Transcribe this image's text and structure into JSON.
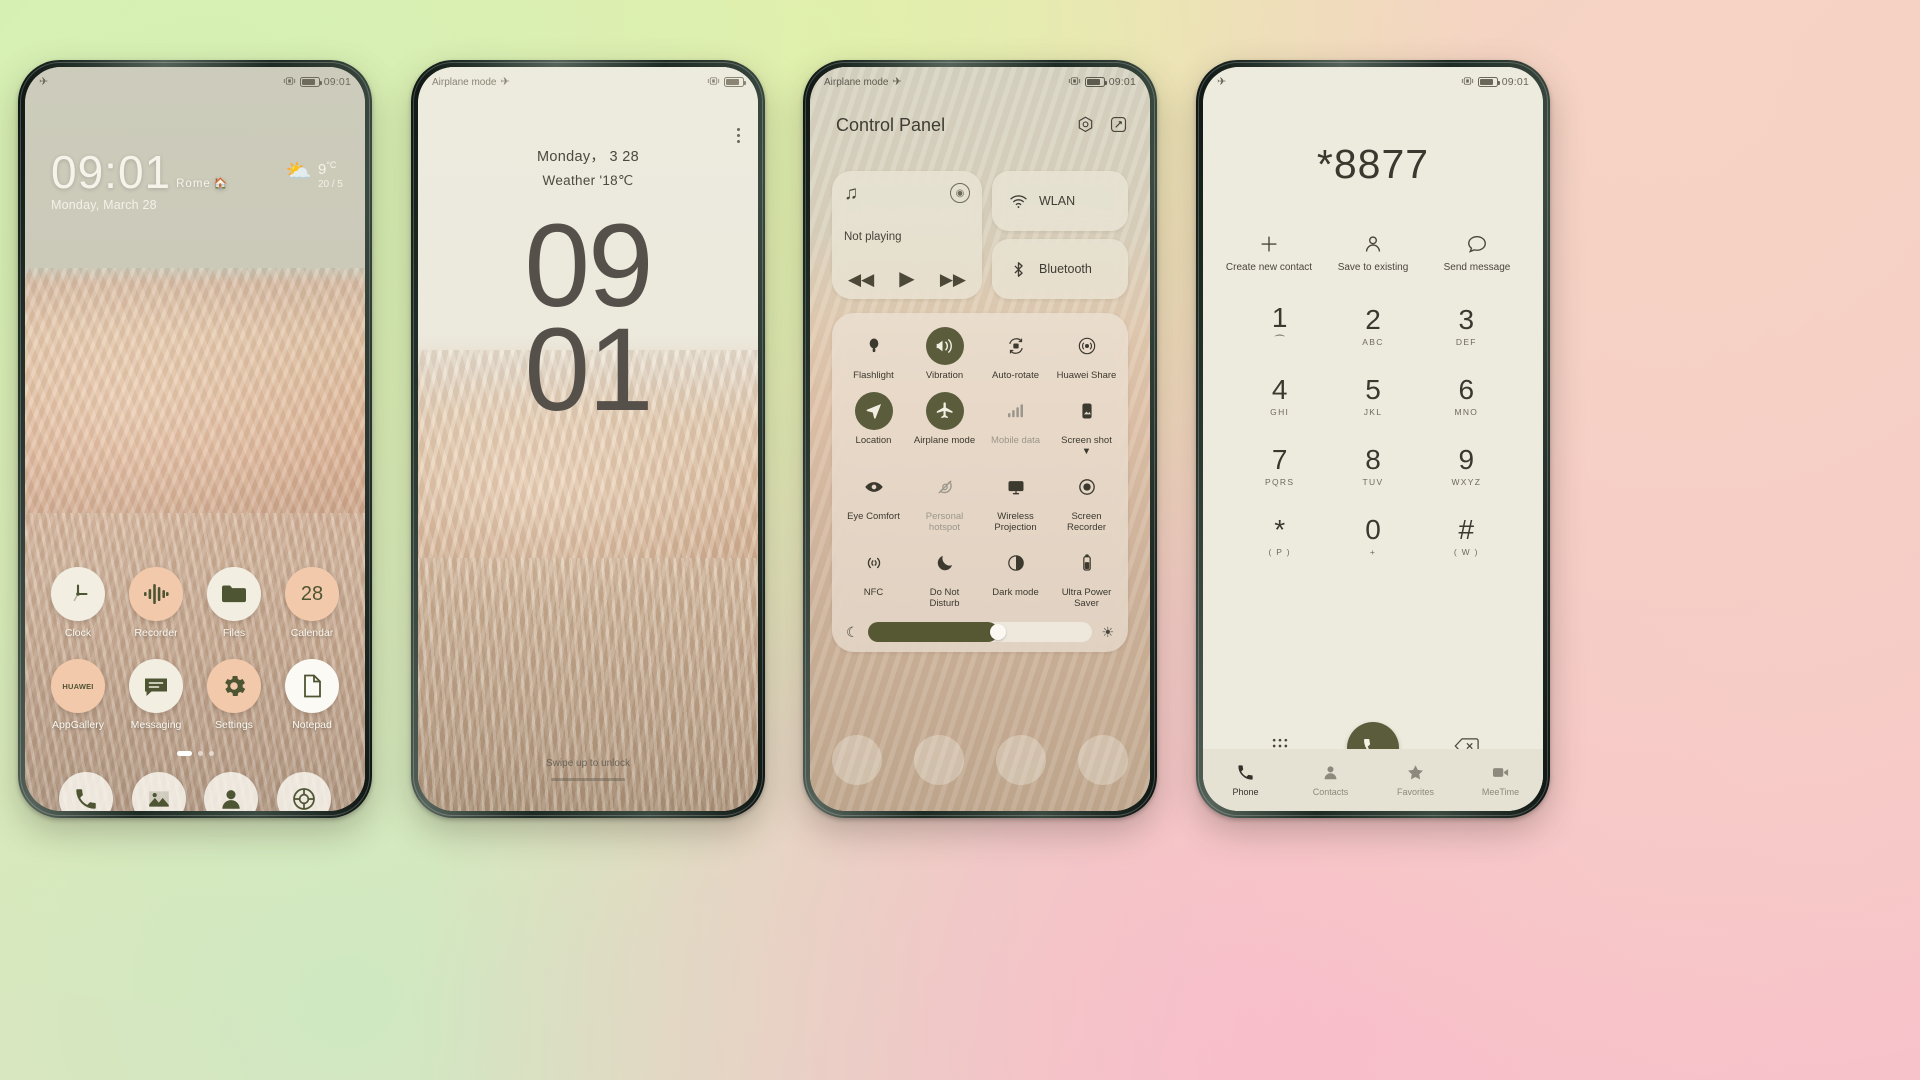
{
  "phone1": {
    "status": {
      "airplane_icon": "airplane-icon",
      "vibrate_icon": "vibrate-icon",
      "battery_icon": "battery-icon",
      "time": "09:01"
    },
    "lock": {
      "time": "09:01",
      "city": "Rome",
      "home_icon": "home-icon",
      "date": "Monday, March 28",
      "weather_icon": "partly-cloudy-icon",
      "temp": "9",
      "temp_unit": "°C",
      "range": "20 / 5"
    },
    "apps_row1": [
      {
        "label": "Clock",
        "icon": "clock-icon",
        "bg": "cream"
      },
      {
        "label": "Recorder",
        "icon": "recorder-icon",
        "bg": "peach"
      },
      {
        "label": "Files",
        "icon": "folder-icon",
        "bg": "cream"
      },
      {
        "label": "Calendar",
        "icon": "calendar-icon",
        "bg": "peach",
        "day": "28"
      }
    ],
    "apps_row2": [
      {
        "label": "AppGallery",
        "icon": "appgallery-icon",
        "bg": "peach",
        "text": "HUAWEI"
      },
      {
        "label": "Messaging",
        "icon": "message-icon",
        "bg": "cream"
      },
      {
        "label": "Settings",
        "icon": "gear-icon",
        "bg": "peach"
      },
      {
        "label": "Notepad",
        "icon": "notepad-icon",
        "bg": "white"
      }
    ],
    "page_dots": 3,
    "active_dot": 0,
    "dock": [
      {
        "label": "Phone",
        "icon": "phone-icon"
      },
      {
        "label": "Gallery",
        "icon": "gallery-icon"
      },
      {
        "label": "Contacts",
        "icon": "contacts-icon"
      },
      {
        "label": "Camera",
        "icon": "camera-icon"
      }
    ]
  },
  "phone2": {
    "status": {
      "airplane_label": "Airplane mode",
      "airplane_icon": "airplane-icon",
      "vibrate_icon": "vibrate-icon",
      "battery_icon": "battery-icon"
    },
    "date": "Monday， 3 28",
    "weather": "Weather '18℃",
    "clock_hh": "09",
    "clock_mm": "01",
    "more_icon": "more-vertical-icon",
    "unlock_hint": "Swipe up to unlock"
  },
  "phone3": {
    "status": {
      "airplane_label": "Airplane mode",
      "airplane_icon": "airplane-icon",
      "vibrate_icon": "vibrate-icon",
      "battery_icon": "battery-icon",
      "time": "09:01"
    },
    "title": "Control Panel",
    "actions": [
      {
        "name": "settings-gear-icon"
      },
      {
        "name": "edit-icon"
      }
    ],
    "media": {
      "note_icon": "music-note-icon",
      "cast_icon": "cast-icon",
      "status": "Not playing",
      "prev_icon": "previous-icon",
      "play_icon": "play-icon",
      "next_icon": "next-icon"
    },
    "connectivity": [
      {
        "label": "WLAN",
        "icon": "wifi-icon"
      },
      {
        "label": "Bluetooth",
        "icon": "bluetooth-icon"
      }
    ],
    "toggles": [
      {
        "label": "Flashlight",
        "icon": "flashlight-icon",
        "state": "off"
      },
      {
        "label": "Vibration",
        "icon": "vibration-icon",
        "state": "on"
      },
      {
        "label": "Auto-rotate",
        "icon": "auto-rotate-icon",
        "state": "off"
      },
      {
        "label": "Huawei Share",
        "icon": "huawei-share-icon",
        "state": "off"
      },
      {
        "label": "Location",
        "icon": "location-icon",
        "state": "on"
      },
      {
        "label": "Airplane mode",
        "icon": "airplane-icon",
        "state": "on"
      },
      {
        "label": "Mobile data",
        "icon": "mobile-data-icon",
        "state": "disabled"
      },
      {
        "label": "Screen shot",
        "icon": "screenshot-icon",
        "state": "off",
        "chevron": true
      },
      {
        "label": "Eye Comfort",
        "icon": "eye-comfort-icon",
        "state": "off"
      },
      {
        "label": "Personal hotspot",
        "icon": "hotspot-icon",
        "state": "disabled"
      },
      {
        "label": "Wireless Projection",
        "icon": "wireless-projection-icon",
        "state": "off"
      },
      {
        "label": "Screen Recorder",
        "icon": "screen-recorder-icon",
        "state": "off"
      },
      {
        "label": "NFC",
        "icon": "nfc-icon",
        "state": "off"
      },
      {
        "label": "Do Not Disturb",
        "icon": "do-not-disturb-icon",
        "state": "off"
      },
      {
        "label": "Dark mode",
        "icon": "dark-mode-icon",
        "state": "off"
      },
      {
        "label": "Ultra Power Saver",
        "icon": "ultra-power-saver-icon",
        "state": "off"
      }
    ],
    "brightness": {
      "min_icon": "moon-icon",
      "max_icon": "sun-icon",
      "value": 58
    }
  },
  "phone4": {
    "status": {
      "airplane_icon": "airplane-icon",
      "vibrate_icon": "vibrate-icon",
      "battery_icon": "battery-icon",
      "time": "09:01"
    },
    "number": "*8877",
    "quick_actions": [
      {
        "label": "Create new contact",
        "icon": "plus-icon"
      },
      {
        "label": "Save to existing",
        "icon": "person-icon"
      },
      {
        "label": "Send message",
        "icon": "message-bubble-icon"
      }
    ],
    "keys": [
      {
        "digit": "1",
        "sub": "⁀",
        "sub_type": "voicemail"
      },
      {
        "digit": "2",
        "sub": "ABC"
      },
      {
        "digit": "3",
        "sub": "DEF"
      },
      {
        "digit": "4",
        "sub": "GHI"
      },
      {
        "digit": "5",
        "sub": "JKL"
      },
      {
        "digit": "6",
        "sub": "MNO"
      },
      {
        "digit": "7",
        "sub": "PQRS"
      },
      {
        "digit": "8",
        "sub": "TUV"
      },
      {
        "digit": "9",
        "sub": "WXYZ"
      },
      {
        "digit": "*",
        "sub": "( P )"
      },
      {
        "digit": "0",
        "sub": "+"
      },
      {
        "digit": "#",
        "sub": "( W )"
      }
    ],
    "dialpad_toggle_icon": "dialpad-icon",
    "call_icon": "call-icon",
    "delete_icon": "backspace-icon",
    "bottom_nav": [
      {
        "label": "Phone",
        "icon": "phone-icon",
        "active": true
      },
      {
        "label": "Contacts",
        "icon": "contacts-icon",
        "active": false
      },
      {
        "label": "Favorites",
        "icon": "star-icon",
        "active": false
      },
      {
        "label": "MeeTime",
        "icon": "meetime-icon",
        "active": false
      }
    ]
  }
}
